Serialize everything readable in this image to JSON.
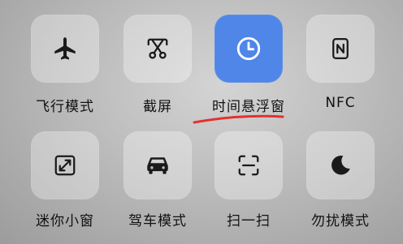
{
  "tiles": [
    {
      "icon": "airplane-icon",
      "label": "飞行模式",
      "active": false
    },
    {
      "icon": "screenshot-scissors-icon",
      "label": "截屏",
      "active": false
    },
    {
      "icon": "clock-icon",
      "label": "时间悬浮窗",
      "active": true
    },
    {
      "icon": "nfc-icon",
      "label": "NFC",
      "active": false
    },
    {
      "icon": "small-window-icon",
      "label": "迷你小窗",
      "active": false
    },
    {
      "icon": "car-icon",
      "label": "驾车模式",
      "active": false
    },
    {
      "icon": "scan-icon",
      "label": "扫一扫",
      "active": false
    },
    {
      "icon": "moon-icon",
      "label": "勿扰模式",
      "active": false
    }
  ],
  "colors": {
    "active_tile": "#4f86e8",
    "annotation_underline": "#e53030"
  }
}
